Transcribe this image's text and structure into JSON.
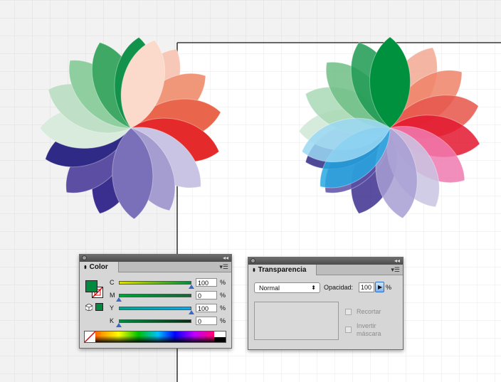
{
  "colors": {
    "canvas_bg": "#ffffff",
    "grid_line": "#dedede",
    "pasteboard": "#eeeeee",
    "fill_swatch": "#008a3e",
    "cyan": "#1aa3dd",
    "magenta_row": "#00843d",
    "yellow": "#e2e100",
    "black_row": "#1f7a3a",
    "slider_thumb": "#3b67c5"
  },
  "color_panel": {
    "title": "Color",
    "sliders": [
      {
        "label": "C",
        "value": "100",
        "unit": "%",
        "level": 100
      },
      {
        "label": "M",
        "value": "0",
        "unit": "%",
        "level": 0
      },
      {
        "label": "Y",
        "value": "100",
        "unit": "%",
        "level": 100
      },
      {
        "label": "K",
        "value": "0",
        "unit": "%",
        "level": 0
      }
    ]
  },
  "transparency_panel": {
    "title": "Transparencia",
    "blend_mode": "Normal",
    "opacity_label": "Opacidad:",
    "opacity_value": "100",
    "opacity_unit": "%",
    "clip_label": "Recortar",
    "invert_label_line1": "Invertir",
    "invert_label_line2": "máscara"
  }
}
